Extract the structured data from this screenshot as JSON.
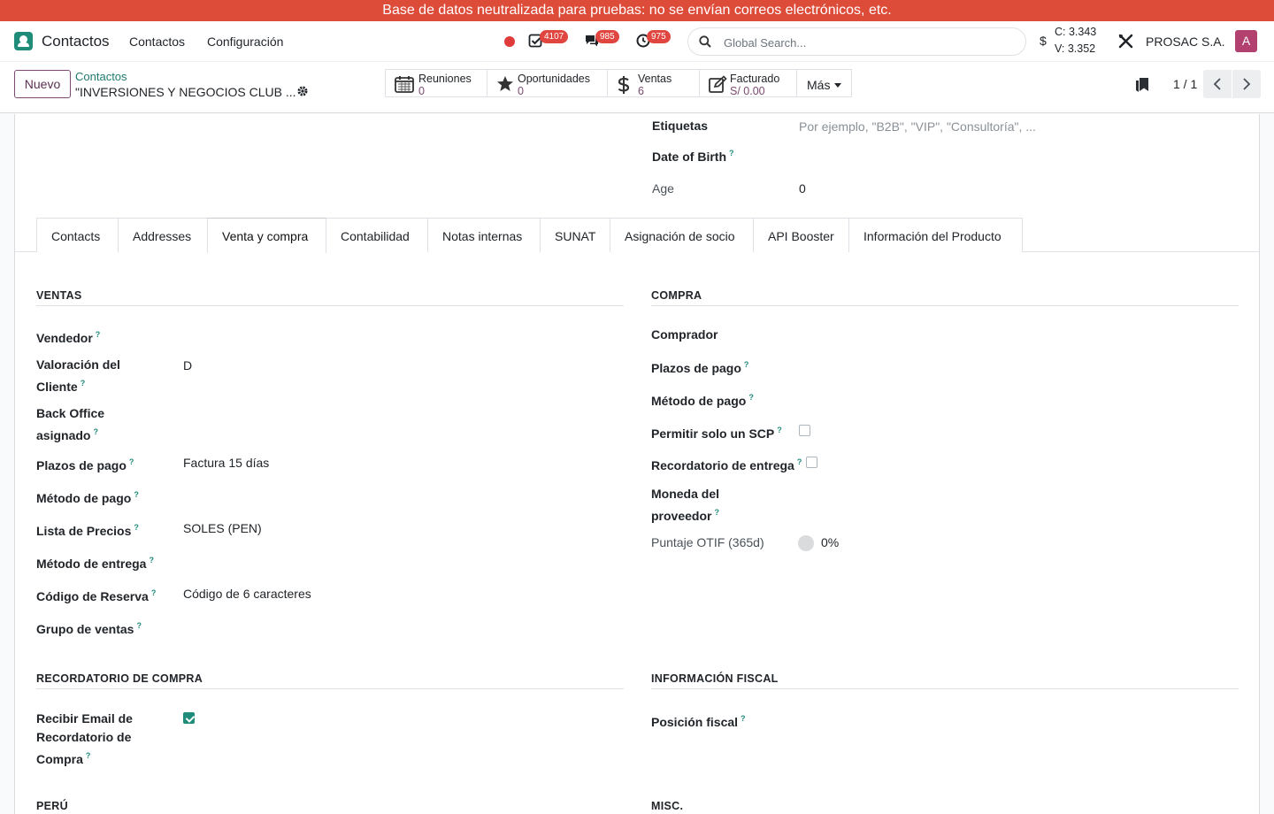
{
  "banner": "Base de datos neutralizada para pruebas: no se envían correos electrónicos, etc.",
  "navbar": {
    "app_name": "Contactos",
    "menus": [
      "Contactos",
      "Configuración"
    ],
    "badges": {
      "activities": "4107",
      "messages": "985",
      "timer": "975"
    },
    "search_placeholder": "Global Search...",
    "currency_symbol": "$",
    "rate_c": "C: 3.343",
    "rate_v": "V: 3.352",
    "company": "PROSAC S.A.",
    "avatar_letter": "A"
  },
  "control": {
    "new_label": "Nuevo",
    "breadcrumb": "Contactos",
    "record_name": "\"INVERSIONES Y NEGOCIOS CLUB ...",
    "smart_buttons": [
      {
        "label": "Reuniones",
        "value": "0",
        "icon": "calendar-icon"
      },
      {
        "label": "Oportunidades",
        "value": "0",
        "icon": "star-icon"
      },
      {
        "label": "Ventas",
        "value": "6",
        "icon": "dollar-icon"
      },
      {
        "label": "Facturado",
        "value": "S/ 0.00",
        "icon": "invoice-icon"
      }
    ],
    "more_label": "Más",
    "pager": "1 / 1"
  },
  "header_fields": {
    "tags_label": "Etiquetas",
    "tags_placeholder": "Por ejemplo, \"B2B\", \"VIP\", \"Consultoría\", ...",
    "dob_label": "Date of Birth",
    "age_label": "Age",
    "age_value": "0"
  },
  "tabs": [
    "Contacts",
    "Addresses",
    "Venta y compra",
    "Contabilidad",
    "Notas internas",
    "SUNAT",
    "Asignación de socio",
    "API Booster",
    "Información del Producto"
  ],
  "active_tab": "Venta y compra",
  "ventas": {
    "title": "VENTAS",
    "vendedor": "Vendedor",
    "valoracion_l1": "Valoración del",
    "valoracion_l2": "Cliente",
    "valoracion_value": "D",
    "backoffice_l1": "Back Office",
    "backoffice_l2": "asignado",
    "plazos_label": "Plazos de pago",
    "plazos_value": "Factura 15 días",
    "metodo_pago": "Método de pago",
    "lista_label": "Lista de Precios",
    "lista_value": "SOLES (PEN)",
    "metodo_entrega": "Método de entrega",
    "codigo_label": "Código de Reserva",
    "codigo_placeholder": "Código de 6 caracteres",
    "grupo": "Grupo de ventas"
  },
  "compra": {
    "title": "COMPRA",
    "comprador": "Comprador",
    "plazos": "Plazos de pago",
    "metodo": "Método de pago",
    "permitir": "Permitir solo un SCP",
    "permitir_checked": false,
    "recordatorio": "Recordatorio de entrega",
    "recordatorio_checked": false,
    "moneda_l1": "Moneda del",
    "moneda_l2": "proveedor",
    "otif_label": "Puntaje OTIF (365d)",
    "otif_value": "0%"
  },
  "recordatorio_compra": {
    "title": "RECORDATORIO DE COMPRA",
    "email_l1": "Recibir Email de",
    "email_l2": "Recordatorio de",
    "email_l3": "Compra",
    "email_checked": true
  },
  "fiscal": {
    "title": "INFORMACIÓN FISCAL",
    "posicion": "Posición fiscal"
  },
  "footer_sections": {
    "peru": "PERÚ",
    "misc": "MISC."
  },
  "colors": {
    "banner": "#dd4b39",
    "accent": "#1f8c7a",
    "brand": "#7d4a72",
    "badge": "#e0463f",
    "avatar": "#b2416f"
  }
}
